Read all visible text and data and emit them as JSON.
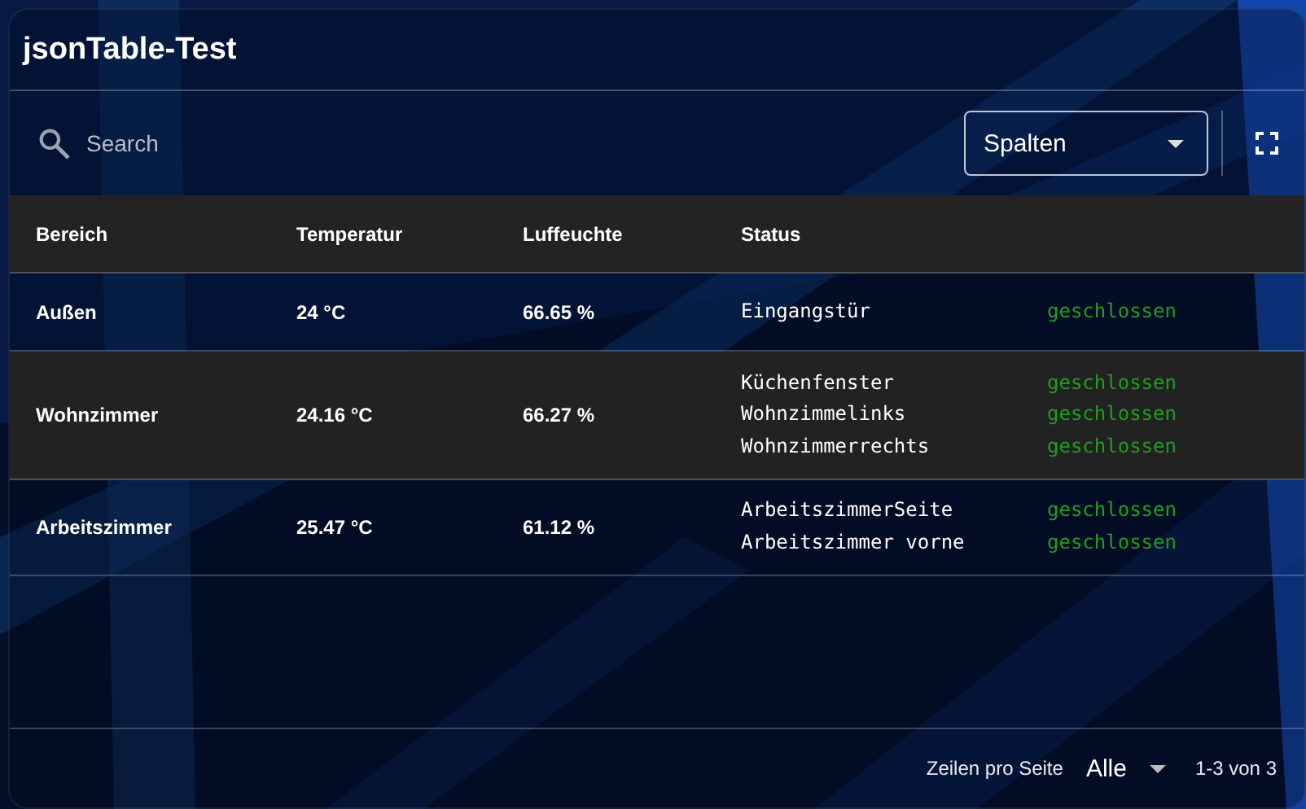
{
  "card": {
    "title": "jsonTable-Test"
  },
  "toolbar": {
    "search": {
      "placeholder": "Search"
    },
    "columns_select": {
      "value": "Spalten"
    }
  },
  "table": {
    "columns": [
      "Bereich",
      "Temperatur",
      "Luffeuchte",
      "Status"
    ],
    "rows": [
      {
        "highlighted": false,
        "cells": [
          "Außen",
          "24 °C",
          "66.65 %"
        ],
        "status": [
          {
            "name": "Eingangstür",
            "state": "geschlossen"
          }
        ]
      },
      {
        "highlighted": true,
        "cells": [
          "Wohnzimmer",
          "24.16 °C",
          "66.27 %"
        ],
        "status": [
          {
            "name": "Küchenfenster",
            "state": "geschlossen"
          },
          {
            "name": "Wohnzimmelinks",
            "state": "geschlossen"
          },
          {
            "name": "Wohnzimmerrechts",
            "state": "geschlossen"
          }
        ]
      },
      {
        "highlighted": false,
        "cells": [
          "Arbeitszimmer",
          "25.47 °C",
          "61.12 %"
        ],
        "status": [
          {
            "name": "ArbeitszimmerSeite",
            "state": "geschlossen"
          },
          {
            "name": "Arbeitszimmer vorne",
            "state": "geschlossen"
          }
        ]
      }
    ]
  },
  "footer": {
    "rows_per_page_label": "Zeilen pro Seite",
    "rows_per_page": "Alle",
    "range": "1-3 von 3"
  }
}
